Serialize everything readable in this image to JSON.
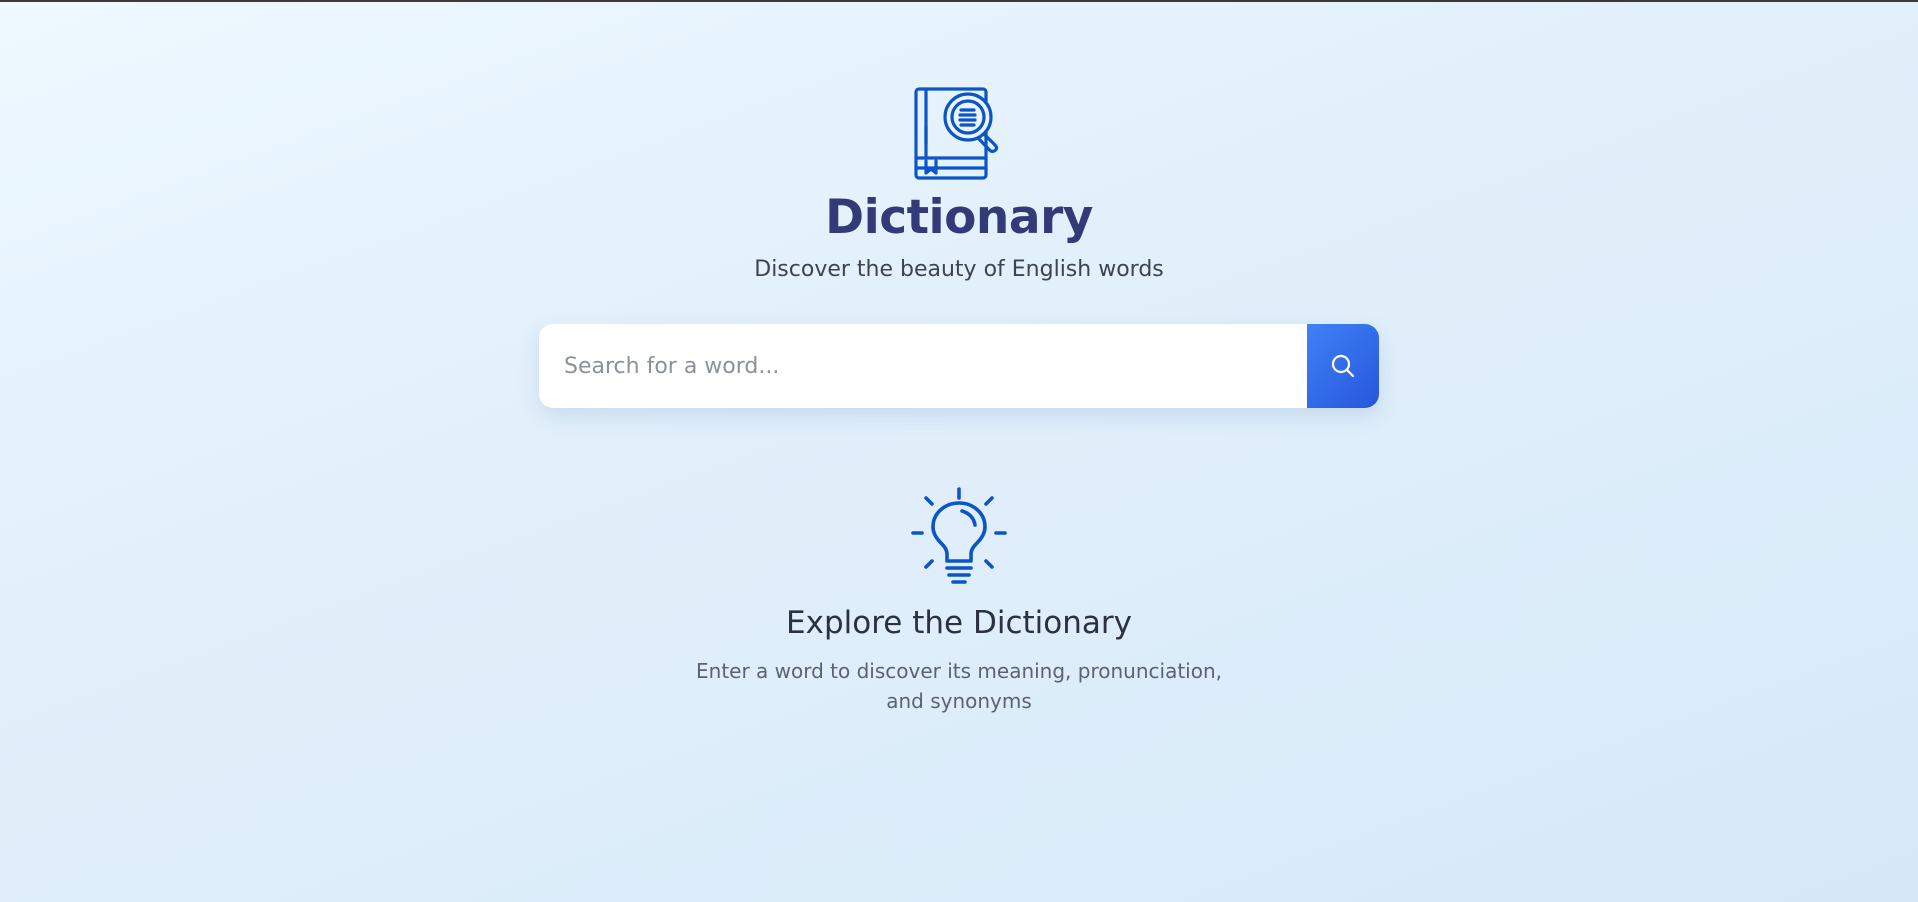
{
  "header": {
    "logo_icon": "dictionary-book-search-icon",
    "title": "Dictionary",
    "subtitle": "Discover the beauty of English words"
  },
  "search": {
    "placeholder": "Search for a word...",
    "value": "",
    "button_icon": "search-icon"
  },
  "empty_state": {
    "icon": "lightbulb-icon",
    "title": "Explore the Dictionary",
    "text": "Enter a word to discover its meaning, pronunciation, and synonyms"
  },
  "colors": {
    "accent": "#0b55c4",
    "title": "#323a78",
    "button_gradient_start": "#3f82f6",
    "button_gradient_end": "#2756db",
    "background_start": "#eef8ff",
    "background_end": "#d6e9f8"
  }
}
